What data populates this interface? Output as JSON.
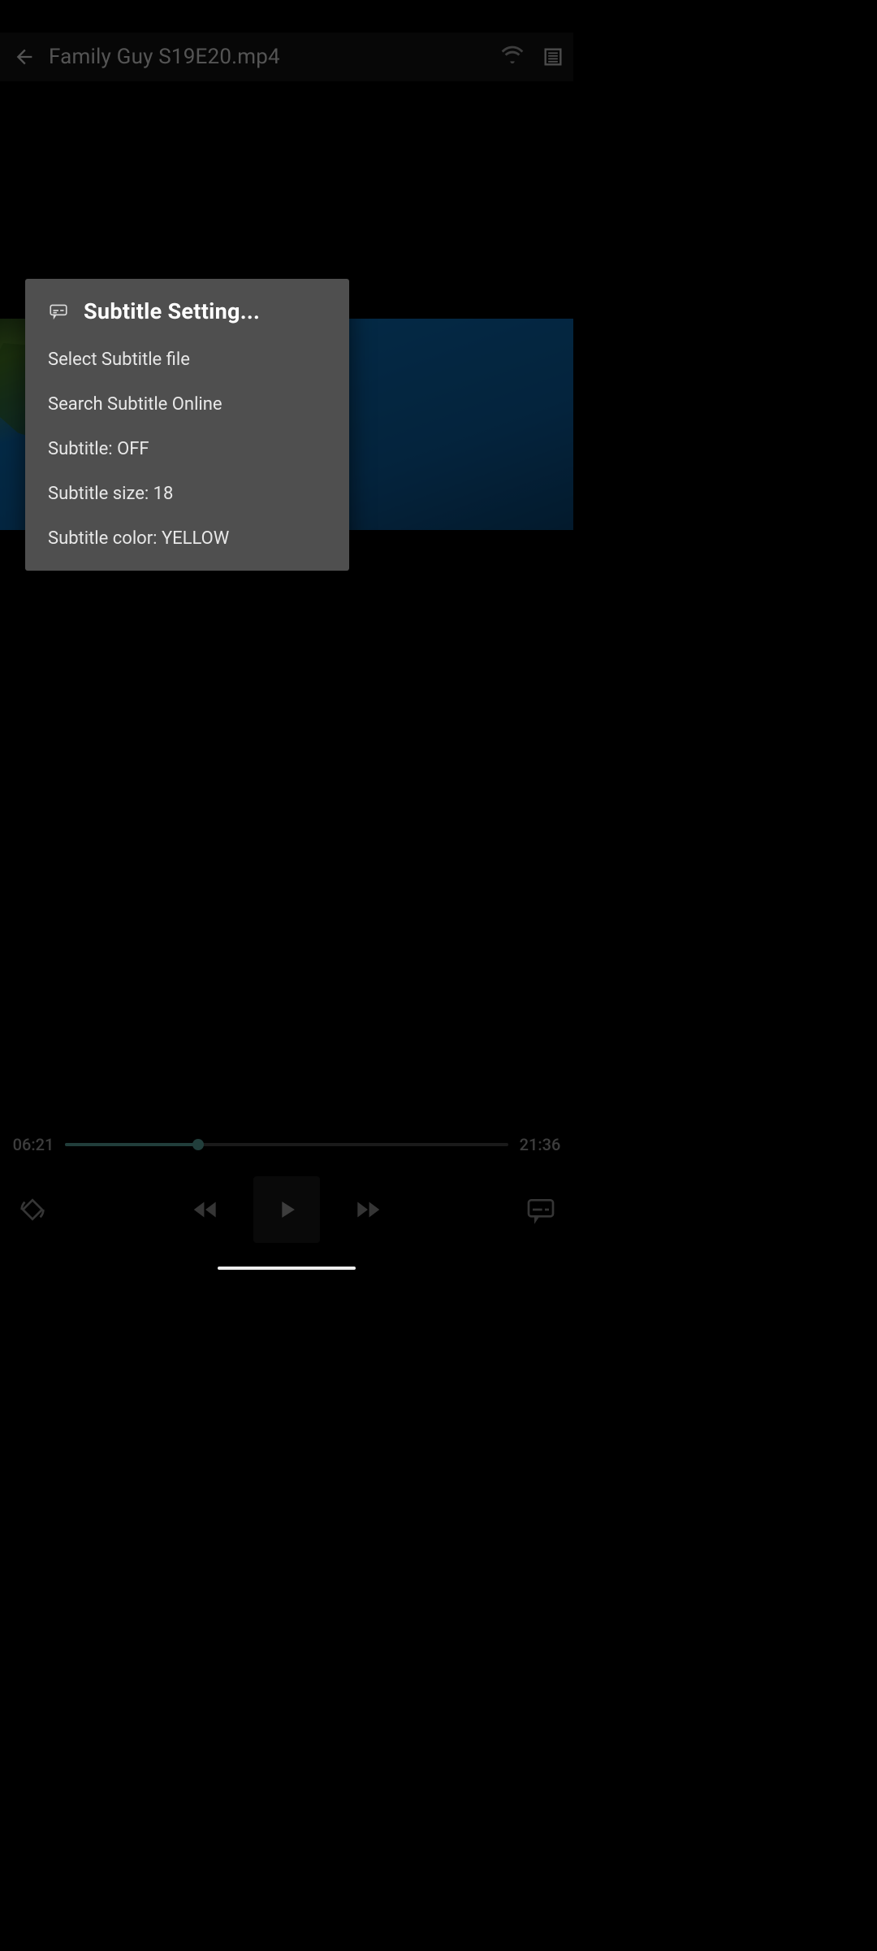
{
  "header": {
    "title": "Family Guy S19E20.mp4"
  },
  "dialog": {
    "title": "Subtitle Setting...",
    "items": {
      "select_file": "Select Subtitle file",
      "search_online": "Search Subtitle Online",
      "toggle": "Subtitle: OFF",
      "size": "Subtitle size: 18",
      "color": "Subtitle color: YELLOW"
    }
  },
  "playback": {
    "elapsed": "06:21",
    "total": "21:36"
  }
}
